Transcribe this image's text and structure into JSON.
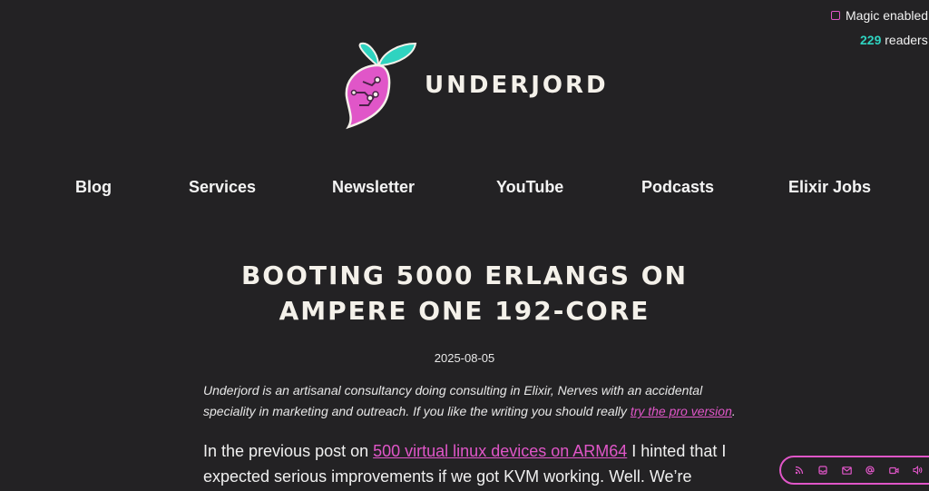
{
  "status": {
    "magic_label": "Magic enabled",
    "readers_count": "229",
    "readers_label": "readers"
  },
  "brand": {
    "name": "UNDERJORD",
    "colors": {
      "accent": "#e056c8",
      "teal": "#2fd3c0",
      "background": "#232224"
    }
  },
  "nav": [
    {
      "label": "Blog"
    },
    {
      "label": "Services"
    },
    {
      "label": "Newsletter"
    },
    {
      "label": "YouTube"
    },
    {
      "label": "Podcasts"
    },
    {
      "label": "Elixir Jobs"
    }
  ],
  "post": {
    "title_line1": "BOOTING 5000 ERLANGS ON",
    "title_line2": "AMPERE ONE 192-CORE",
    "date": "2025-08-05",
    "intro_text": "Underjord is an artisanal consultancy doing consulting in Elixir, Nerves with an accidental speciality in marketing and outreach. If you like the writing you should really ",
    "intro_link": "try the pro version",
    "intro_end": ".",
    "body_prefix": "In the previous post on ",
    "body_link": "500 virtual linux devices on ARM64",
    "body_suffix": " I hinted that I expected serious improvements if we got KVM working. Well. We’re"
  },
  "floating_icons": [
    "rss-icon",
    "inbox-icon",
    "mail-icon",
    "at-icon",
    "video-icon",
    "speaker-icon"
  ]
}
